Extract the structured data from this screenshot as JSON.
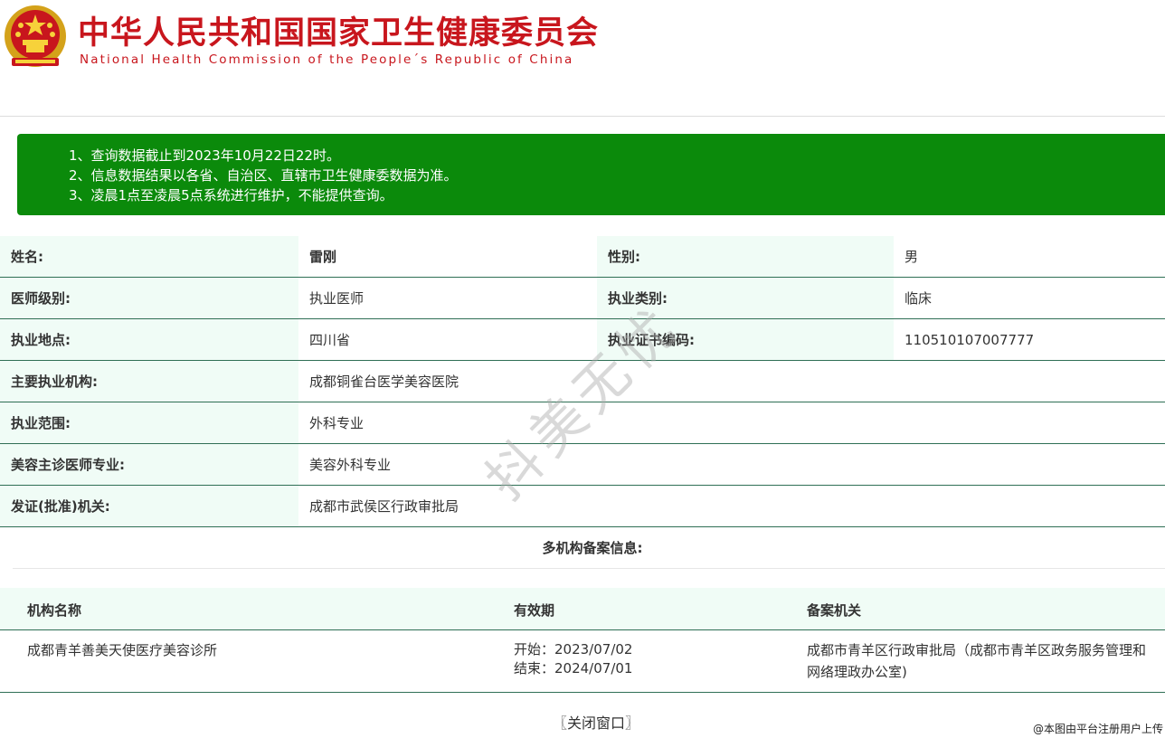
{
  "header": {
    "title_cn": "中华人民共和国国家卫生健康委员会",
    "title_en": "National Health Commission of the People´s Republic of China"
  },
  "notice": {
    "lines": [
      "1、查询数据截止到2023年10月22日22时。",
      "2、信息数据结果以各省、自治区、直辖市卫生健康委数据为准。",
      "3、凌晨1点至凌晨5点系统进行维护，不能提供查询。"
    ]
  },
  "info": {
    "name_label": "姓名:",
    "name_value": "雷刚",
    "gender_label": "性别:",
    "gender_value": "男",
    "level_label": "医师级别:",
    "level_value": "执业医师",
    "category_label": "执业类别:",
    "category_value": "临床",
    "place_label": "执业地点:",
    "place_value": "四川省",
    "cert_label": "执业证书编码:",
    "cert_value": "110510107007777",
    "institution_label": "主要执业机构:",
    "institution_value": "成都铜雀台医学美容医院",
    "scope_label": "执业范围:",
    "scope_value": "外科专业",
    "specialty_label": "美容主诊医师专业:",
    "specialty_value": "美容外科专业",
    "issuer_label": "发证(批准)机关:",
    "issuer_value": "成都市武侯区行政审批局"
  },
  "multi": {
    "title": "多机构备案信息:",
    "headers": [
      "机构名称",
      "有效期",
      "备案机关"
    ],
    "rows": [
      {
        "name": "成都青羊善美天使医疗美容诊所",
        "start": "开始：2023/07/02",
        "end": "结束：2024/07/01",
        "authority_line1": "成都市青羊区行政审批局（成都市青羊区政务服务管理和",
        "authority_line2": "网络理政办公室)"
      }
    ]
  },
  "close_label": "〖关闭窗口〗",
  "watermark": "抖美无忧",
  "corner_mark": "@本图由平台注册用户上传",
  "colors": {
    "brand_red": "#c8161d",
    "notice_green": "#0b8a0b",
    "label_bg": "#f0fcf6",
    "row_border": "#2f6f55"
  }
}
